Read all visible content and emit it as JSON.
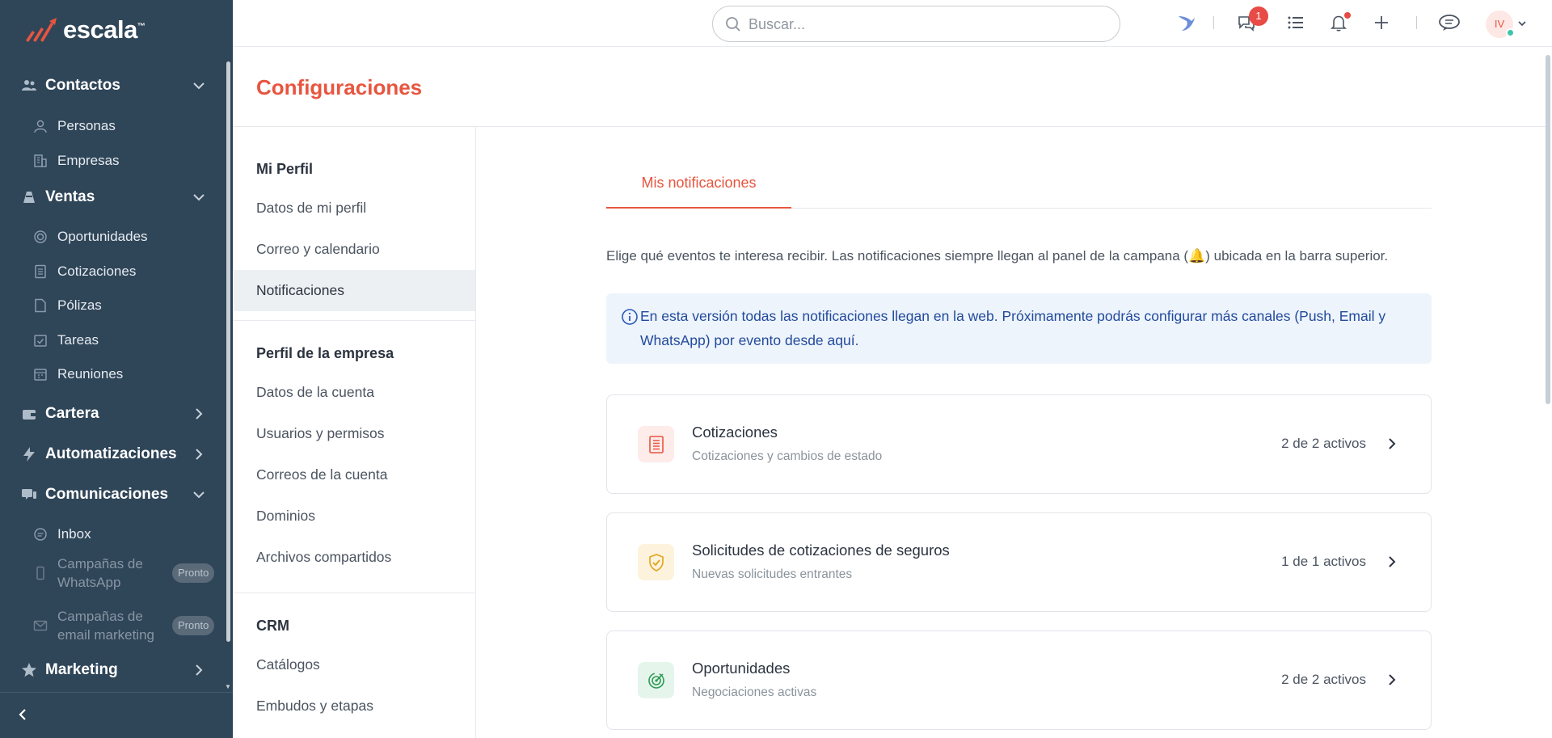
{
  "brand": {
    "name": "escala",
    "tm": "™"
  },
  "sidebar": {
    "groups": [
      {
        "label": "Contactos",
        "icon": "contacts-icon",
        "expanded": true,
        "items": [
          {
            "label": "Personas",
            "icon": "person-icon"
          },
          {
            "label": "Empresas",
            "icon": "building-icon"
          }
        ]
      },
      {
        "label": "Ventas",
        "icon": "sales-icon",
        "expanded": true,
        "items": [
          {
            "label": "Oportunidades",
            "icon": "target-icon"
          },
          {
            "label": "Cotizaciones",
            "icon": "document-icon"
          },
          {
            "label": "Pólizas",
            "icon": "file-icon"
          },
          {
            "label": "Tareas",
            "icon": "checkbox-calendar-icon"
          },
          {
            "label": "Reuniones",
            "icon": "calendar-icon"
          }
        ]
      },
      {
        "label": "Cartera",
        "icon": "wallet-icon",
        "expanded": false
      },
      {
        "label": "Automatizaciones",
        "icon": "lightning-icon",
        "expanded": false
      },
      {
        "label": "Comunicaciones",
        "icon": "chat-icon",
        "expanded": true,
        "items": [
          {
            "label": "Inbox",
            "icon": "inbox-icon"
          },
          {
            "label": "Campañas de WhatsApp",
            "line1": "Campañas de",
            "line2": "WhatsApp",
            "icon": "phone-icon",
            "badge": "Pronto"
          },
          {
            "label": "Campañas de email marketing",
            "line1": "Campañas de",
            "line2": "email marketing",
            "icon": "mail-icon",
            "badge": "Pronto"
          }
        ]
      },
      {
        "label": "Marketing",
        "icon": "star-icon",
        "expanded": false
      }
    ]
  },
  "topbar": {
    "search_placeholder": "Buscar...",
    "chat_badge": "1",
    "avatar_initials": "IV"
  },
  "page": {
    "title": "Configuraciones"
  },
  "settings_menu": {
    "sections": [
      {
        "heading": "Mi Perfil",
        "items": [
          "Datos de mi perfil",
          "Correo y calendario",
          "Notificaciones"
        ]
      },
      {
        "heading": "Perfil de la empresa",
        "items": [
          "Datos de la cuenta",
          "Usuarios y permisos",
          "Correos de la cuenta",
          "Dominios",
          "Archivos compartidos"
        ]
      },
      {
        "heading": "CRM",
        "items": [
          "Catálogos",
          "Embudos y etapas"
        ]
      }
    ],
    "active": "Notificaciones"
  },
  "content": {
    "tab": "Mis notificaciones",
    "description": "Elige qué eventos te interesa recibir. Las notificaciones siempre llegan al panel de la campana (🔔) ubicada en la barra superior.",
    "info": "En esta versión todas las notificaciones llegan en la web. Próximamente podrás configurar más canales (Push, Email y WhatsApp) por evento desde aquí.",
    "cards": [
      {
        "title": "Cotizaciones",
        "subtitle": "Cotizaciones y cambios de estado",
        "status": "2 de 2 activos",
        "icon": "document-icon",
        "color": "#e8553f",
        "bg": "#fdecea"
      },
      {
        "title": "Solicitudes de cotizaciones de seguros",
        "subtitle": "Nuevas solicitudes entrantes",
        "status": "1 de 1 activos",
        "icon": "shield-check-icon",
        "color": "#e3a21a",
        "bg": "#fdf3dd"
      },
      {
        "title": "Oportunidades",
        "subtitle": "Negociaciones activas",
        "status": "2 de 2 activos",
        "icon": "target-icon",
        "color": "#2e9b57",
        "bg": "#e5f5eb"
      }
    ]
  }
}
